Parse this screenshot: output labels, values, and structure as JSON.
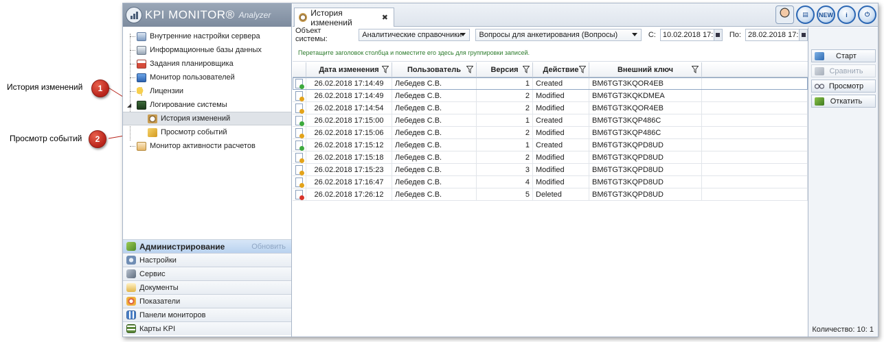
{
  "callouts": [
    {
      "number": "1",
      "label": "История изменений"
    },
    {
      "number": "2",
      "label": "Просмотр событий"
    }
  ],
  "app": {
    "logo_text": "KPI MONITOR®",
    "logo_sub": "Analyzer"
  },
  "tree": {
    "items": [
      {
        "label": "Внутренние настройки сервера",
        "icon": "server-settings-icon"
      },
      {
        "label": "Информационные базы данных",
        "icon": "database-icon"
      },
      {
        "label": "Задания планировщика",
        "icon": "calendar-icon"
      },
      {
        "label": "Монитор пользователей",
        "icon": "monitor-icon"
      },
      {
        "label": "Лицензии",
        "icon": "key-icon"
      },
      {
        "label": "Логирование системы",
        "icon": "log-icon"
      },
      {
        "label": "История изменений",
        "icon": "history-icon"
      },
      {
        "label": "Просмотр событий",
        "icon": "events-icon"
      },
      {
        "label": "Монитор активности расчетов",
        "icon": "activity-icon"
      }
    ]
  },
  "nav": {
    "admin": "Администрирование",
    "refresh": "Обновить",
    "settings": "Настройки",
    "service": "Сервис",
    "documents": "Документы",
    "indicators": "Показатели",
    "panels": "Панели мониторов",
    "maps": "Карты KPI"
  },
  "tab": {
    "title": "История изменений",
    "close": "✖"
  },
  "top_icons": [
    "user-avatar-icon",
    "sheet-icon",
    "new-icon",
    "info-icon",
    "power-icon"
  ],
  "top_icon_labels": {
    "new": "NEW",
    "info": "i",
    "power": "⏻",
    "sheet": "▤"
  },
  "filter": {
    "object_label": "Объект системы:",
    "object_value": "Аналитические справочники",
    "questions_value": "Вопросы для анкетирования (Вопросы)",
    "from_label": "С:",
    "from_value": "10.02.2018 17:13",
    "to_label": "По:",
    "to_value": "28.02.2018 17:13"
  },
  "group_hint": "Перетащите заголовок столбца и поместите его здесь для группировки записей.",
  "grid": {
    "columns": [
      "Дата изменения",
      "Пользователь",
      "Версия",
      "Действие",
      "Внешний ключ"
    ],
    "rows": [
      {
        "date": "26.02.2018 17:14:49",
        "user": "Лебедев С.В.",
        "version": "1",
        "action": "Created",
        "key": "BM6TGT3KQOR4EB",
        "kind": "created"
      },
      {
        "date": "26.02.2018 17:14:49",
        "user": "Лебедев С.В.",
        "version": "2",
        "action": "Modified",
        "key": "BM6TGT3KQKDMEA",
        "kind": "modified"
      },
      {
        "date": "26.02.2018 17:14:54",
        "user": "Лебедев С.В.",
        "version": "2",
        "action": "Modified",
        "key": "BM6TGT3KQOR4EB",
        "kind": "modified"
      },
      {
        "date": "26.02.2018 17:15:00",
        "user": "Лебедев С.В.",
        "version": "1",
        "action": "Created",
        "key": "BM6TGT3KQP486C",
        "kind": "created"
      },
      {
        "date": "26.02.2018 17:15:06",
        "user": "Лебедев С.В.",
        "version": "2",
        "action": "Modified",
        "key": "BM6TGT3KQP486C",
        "kind": "modified"
      },
      {
        "date": "26.02.2018 17:15:12",
        "user": "Лебедев С.В.",
        "version": "1",
        "action": "Created",
        "key": "BM6TGT3KQPD8UD",
        "kind": "created"
      },
      {
        "date": "26.02.2018 17:15:18",
        "user": "Лебедев С.В.",
        "version": "2",
        "action": "Modified",
        "key": "BM6TGT3KQPD8UD",
        "kind": "modified"
      },
      {
        "date": "26.02.2018 17:15:23",
        "user": "Лебедев С.В.",
        "version": "3",
        "action": "Modified",
        "key": "BM6TGT3KQPD8UD",
        "kind": "modified"
      },
      {
        "date": "26.02.2018 17:16:47",
        "user": "Лебедев С.В.",
        "version": "4",
        "action": "Modified",
        "key": "BM6TGT3KQPD8UD",
        "kind": "modified"
      },
      {
        "date": "26.02.2018 17:26:12",
        "user": "Лебедев С.В.",
        "version": "5",
        "action": "Deleted",
        "key": "BM6TGT3KQPD8UD",
        "kind": "deleted"
      }
    ]
  },
  "actions": {
    "start": "Старт",
    "compare": "Сравнить",
    "view": "Просмотр",
    "rollback": "Откатить",
    "count": "Количество: 10: 1"
  }
}
